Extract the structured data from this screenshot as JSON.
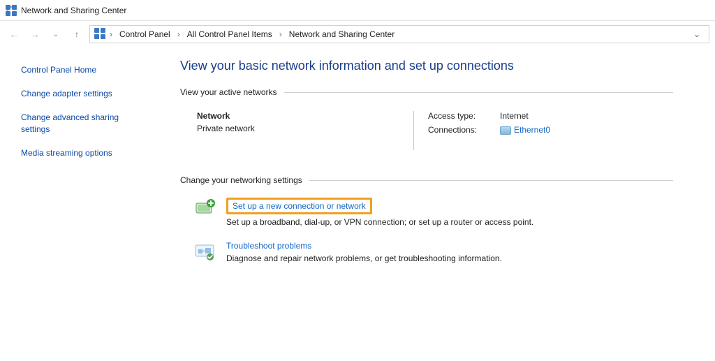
{
  "window": {
    "title": "Network and Sharing Center"
  },
  "breadcrumb": {
    "items": [
      "Control Panel",
      "All Control Panel Items",
      "Network and Sharing Center"
    ]
  },
  "sidebar": {
    "items": [
      {
        "label": "Control Panel Home"
      },
      {
        "label": "Change adapter settings"
      },
      {
        "label": "Change advanced sharing settings"
      },
      {
        "label": "Media streaming options"
      }
    ]
  },
  "main": {
    "title": "View your basic network information and set up connections",
    "active_heading": "View your active networks",
    "network": {
      "name": "Network",
      "type": "Private network",
      "access_label": "Access type:",
      "access_value": "Internet",
      "connections_label": "Connections:",
      "connections_value": "Ethernet0"
    },
    "change_heading": "Change your networking settings",
    "tasks": [
      {
        "title": "Set up a new connection or network",
        "desc": "Set up a broadband, dial-up, or VPN connection; or set up a router or access point.",
        "highlighted": true
      },
      {
        "title": "Troubleshoot problems",
        "desc": "Diagnose and repair network problems, or get troubleshooting information.",
        "highlighted": false
      }
    ]
  }
}
